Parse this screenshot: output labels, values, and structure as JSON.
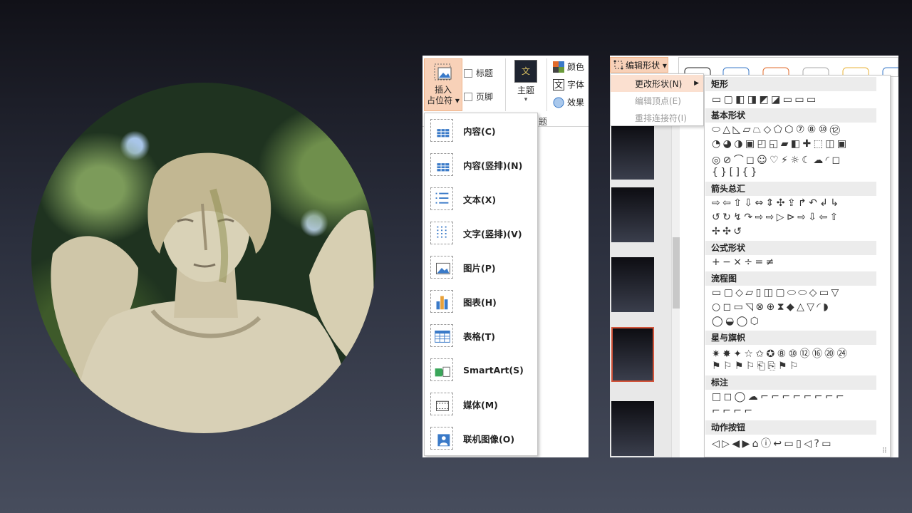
{
  "insert_ribbon": {
    "insert_placeholder": [
      "插入",
      "占位符 ▾"
    ],
    "title_check": "标题",
    "footer_check": "页脚",
    "theme_label": "主题",
    "theme_glyph": "文",
    "color_label": "颜色",
    "font_label": "字体",
    "effect_label": "效果",
    "group_tail": "题"
  },
  "placeholder_menu": [
    {
      "label": "内容(C)",
      "icon": "content-grid-icon"
    },
    {
      "label": "内容(竖排)(N)",
      "icon": "content-vertical-icon"
    },
    {
      "label": "文本(X)",
      "icon": "text-lines-icon"
    },
    {
      "label": "文字(竖排)(V)",
      "icon": "text-vertical-icon"
    },
    {
      "label": "图片(P)",
      "icon": "picture-icon"
    },
    {
      "label": "图表(H)",
      "icon": "chart-icon"
    },
    {
      "label": "表格(T)",
      "icon": "table-icon"
    },
    {
      "label": "SmartArt(S)",
      "icon": "smartart-icon"
    },
    {
      "label": "媒体(M)",
      "icon": "media-icon"
    },
    {
      "label": "联机图像(O)",
      "icon": "online-image-icon"
    }
  ],
  "edit_shape": {
    "button_label": "编辑形状 ▾",
    "submenu": [
      {
        "label": "更改形状(N)",
        "enabled": true
      },
      {
        "label": "编辑顶点(E)",
        "enabled": false
      },
      {
        "label": "重排连接符(I)",
        "enabled": false
      }
    ]
  },
  "shape_gallery": {
    "groups": [
      {
        "title": "矩形",
        "rows": [
          "▭▢◧◨◩◪▭▭▭"
        ]
      },
      {
        "title": "基本形状",
        "rows": [
          "⬭△◺▱⏢◇⬠⬡⑦⑧⑩⑫",
          "◔◕◑▣◰◱▰◧✚⬚◫▣",
          "◎⊘⌒◻☺♡⚡☼☾☁◜◻",
          "{}[]{}"
        ]
      },
      {
        "title": "箭头总汇",
        "rows": [
          "⇨⇦⇧⇩⇔⇕✣⇪↱↶↲↳",
          "↺↻↯↷⇨⇨▷⊳⇨⇩⇦⇧",
          "✢✣↺"
        ]
      },
      {
        "title": "公式形状",
        "rows": [
          "+−×÷=≠"
        ]
      },
      {
        "title": "流程图",
        "rows": [
          "▭▢◇▱▯◫▢⬭⬭◇▭▽",
          "○◻▭◹⊗⊕⧗◆△▽◜◗",
          "◯◒◯⬡"
        ]
      },
      {
        "title": "星与旗帜",
        "rows": [
          "✷✸✦☆✩✪⑧⑩⑫⑯⑳㉔",
          "⚑⚐⚑⚐⎗⎘⚑⚐"
        ]
      },
      {
        "title": "标注",
        "rows": [
          "□◻◯☁⌐⌐⌐⌐⌐⌐⌐⌐",
          "⌐⌐⌐⌐"
        ]
      },
      {
        "title": "动作按钮",
        "rows": [
          "◁▷◀▶⌂ⓘ↩▭▯◁?▭"
        ]
      }
    ]
  }
}
